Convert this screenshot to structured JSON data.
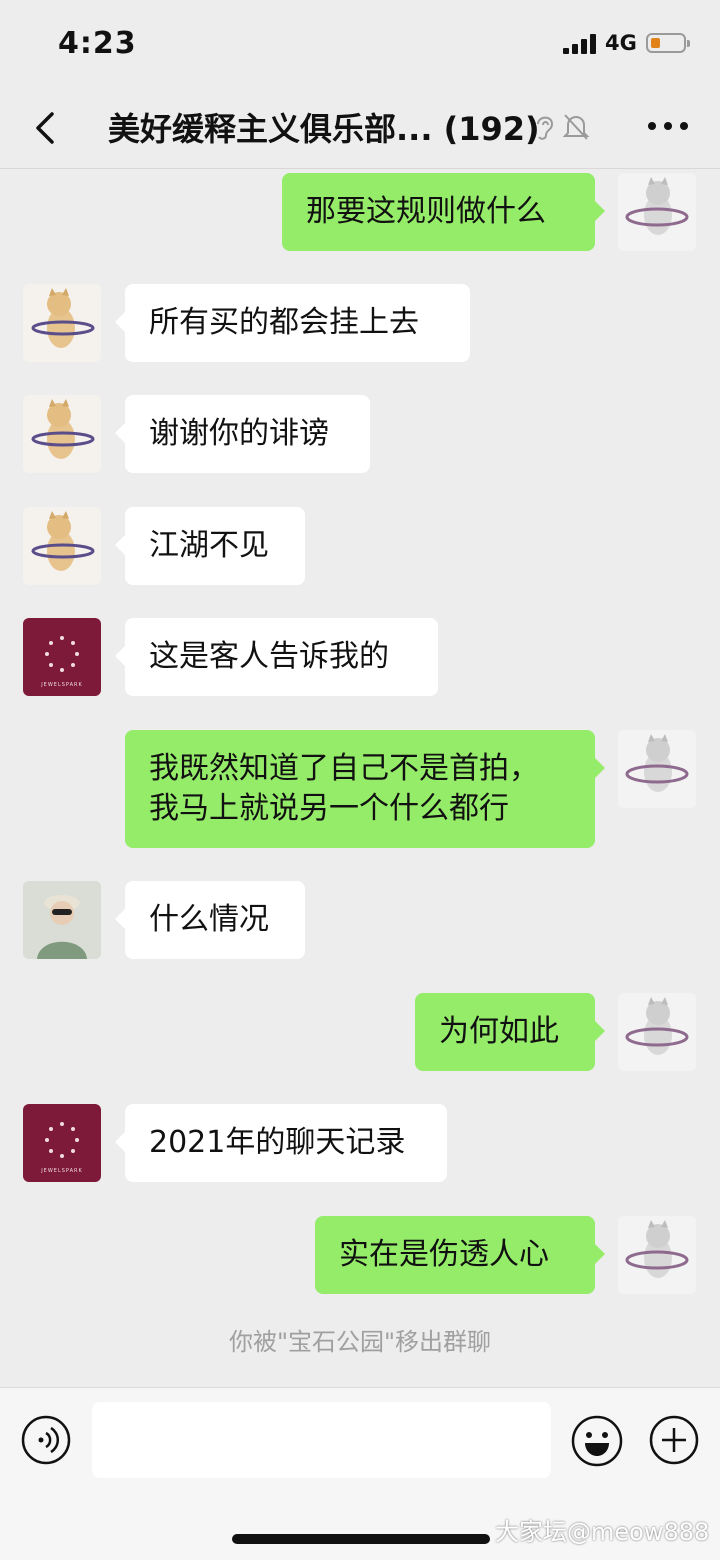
{
  "status_bar": {
    "time": "4:23",
    "network": "4G"
  },
  "nav": {
    "title": "美好缓释主义俱乐部... (192)"
  },
  "messages": [
    {
      "side": "out",
      "avatar": "cat-hula-hoop-avatar",
      "text": "那要这规则做什么"
    },
    {
      "side": "in",
      "avatar": "cat-hula-hoop-avatar",
      "text": "所有买的都会挂上去"
    },
    {
      "side": "in",
      "avatar": "cat-hula-hoop-avatar",
      "text": "谢谢你的诽谤"
    },
    {
      "side": "in",
      "avatar": "cat-hula-hoop-avatar",
      "text": "江湖不见"
    },
    {
      "side": "in",
      "avatar": "jewelspark-logo-avatar",
      "avatar_text": "JEWELSPARK",
      "text": "这是客人告诉我的"
    },
    {
      "side": "out",
      "avatar": "cat-hula-hoop-avatar",
      "text": "我既然知道了自己不是首拍，",
      "text2": "我马上就说另一个什么都行"
    },
    {
      "side": "in",
      "avatar": "person-photo-avatar",
      "text": "什么情况"
    },
    {
      "side": "out",
      "avatar": "cat-hula-hoop-avatar",
      "text": "为何如此"
    },
    {
      "side": "in",
      "avatar": "jewelspark-logo-avatar",
      "avatar_text": "JEWELSPARK",
      "text": "2021年的聊天记录"
    },
    {
      "side": "out",
      "avatar": "cat-hula-hoop-avatar",
      "text": "实在是伤透人心"
    }
  ],
  "system_note": "你被\"宝石公园\"移出群聊",
  "watermark": "大家坛@meow888",
  "colors": {
    "outgoing_bubble": "#95ec69",
    "incoming_bubble": "#ffffff",
    "background": "#ededed",
    "brand_avatar": "#7d1a3a"
  }
}
